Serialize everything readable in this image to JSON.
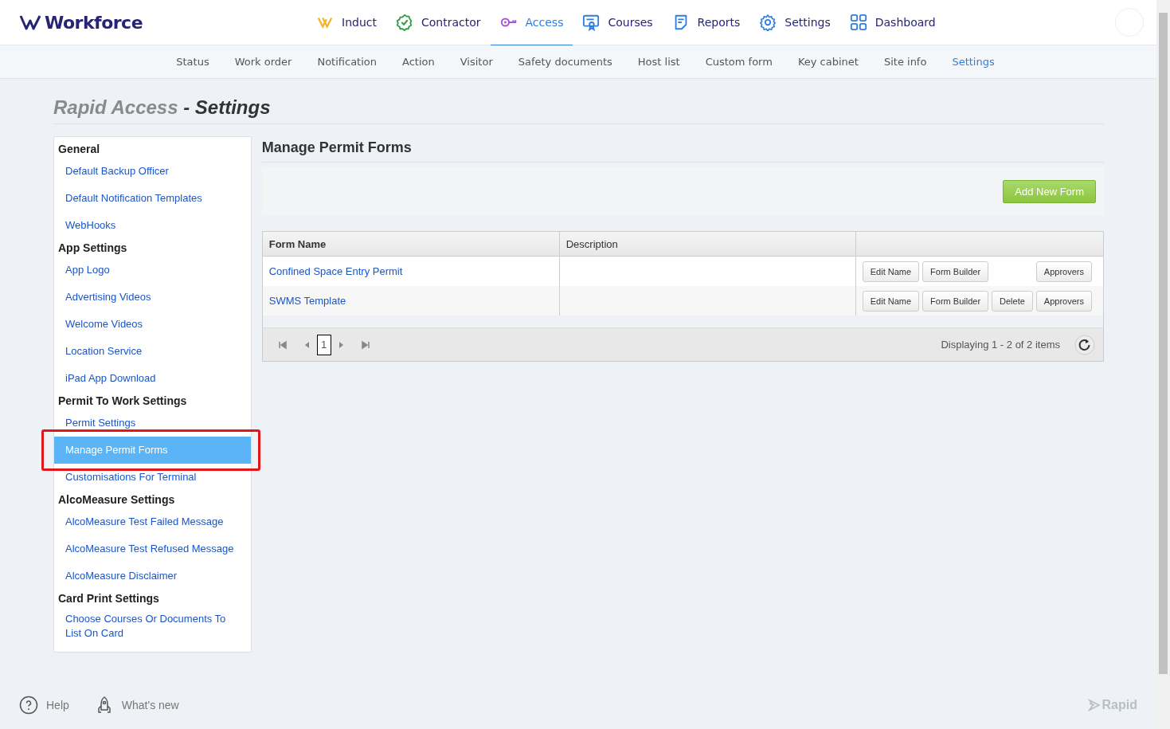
{
  "header": {
    "logo": "Workforce",
    "nav": [
      {
        "label": "Induct",
        "selected": false
      },
      {
        "label": "Contractor",
        "selected": false
      },
      {
        "label": "Access",
        "selected": true
      },
      {
        "label": "Courses",
        "selected": false
      },
      {
        "label": "Reports",
        "selected": false
      },
      {
        "label": "Settings",
        "selected": false
      },
      {
        "label": "Dashboard",
        "selected": false
      }
    ]
  },
  "subnav": [
    {
      "label": "Status",
      "selected": false
    },
    {
      "label": "Work order",
      "selected": false
    },
    {
      "label": "Notification",
      "selected": false
    },
    {
      "label": "Action",
      "selected": false
    },
    {
      "label": "Visitor",
      "selected": false
    },
    {
      "label": "Safety documents",
      "selected": false
    },
    {
      "label": "Host list",
      "selected": false
    },
    {
      "label": "Custom form",
      "selected": false
    },
    {
      "label": "Key cabinet",
      "selected": false
    },
    {
      "label": "Site info",
      "selected": false
    },
    {
      "label": "Settings",
      "selected": true
    }
  ],
  "page": {
    "title_prefix": "Rapid Access",
    "title": " - Settings"
  },
  "sidebar": {
    "groups": [
      {
        "heading": "General",
        "items": [
          {
            "label": "Default Backup Officer",
            "selected": false
          },
          {
            "label": "Default Notification Templates",
            "selected": false
          },
          {
            "label": "WebHooks",
            "selected": false
          }
        ]
      },
      {
        "heading": "App Settings",
        "items": [
          {
            "label": "App Logo",
            "selected": false
          },
          {
            "label": "Advertising Videos",
            "selected": false
          },
          {
            "label": "Welcome Videos",
            "selected": false
          },
          {
            "label": "Location Service",
            "selected": false
          },
          {
            "label": "iPad App Download",
            "selected": false
          }
        ]
      },
      {
        "heading": "Permit To Work Settings",
        "items": [
          {
            "label": "Permit Settings",
            "selected": false
          },
          {
            "label": "Manage Permit Forms",
            "selected": true
          },
          {
            "label": "Customisations For Terminal",
            "selected": false
          }
        ]
      },
      {
        "heading": "AlcoMeasure Settings",
        "items": [
          {
            "label": "AlcoMeasure Test Failed Message",
            "selected": false
          },
          {
            "label": "AlcoMeasure Test Refused Message",
            "selected": false
          },
          {
            "label": "AlcoMeasure Disclaimer",
            "selected": false
          }
        ]
      },
      {
        "heading": "Card Print Settings",
        "items": [
          {
            "label": "Choose Courses Or Documents To List On Card",
            "selected": false
          }
        ]
      }
    ]
  },
  "main": {
    "heading": "Manage Permit Forms",
    "add_button": "Add New Form",
    "table": {
      "columns": [
        "Form Name",
        "Description"
      ],
      "rows": [
        {
          "name": "Confined Space Entry Permit",
          "actions": [
            {
              "label": "Edit Name",
              "kind": "edit"
            },
            {
              "label": "Form Builder",
              "kind": "builder"
            },
            {
              "label": "Approvers",
              "kind": "approvers"
            }
          ]
        },
        {
          "name": "SWMS Template",
          "actions": [
            {
              "label": "Edit Name",
              "kind": "edit"
            },
            {
              "label": "Form Builder",
              "kind": "builder"
            },
            {
              "label": "Delete",
              "kind": "delete"
            },
            {
              "label": "Approvers",
              "kind": "approvers"
            }
          ]
        }
      ],
      "pages": [
        {
          "label": "1",
          "selected": true
        }
      ],
      "summary": "Displaying 1 - 2 of 2 items"
    }
  },
  "footer": {
    "help": "Help",
    "whats_new": "What's new",
    "brand": "Rapid"
  }
}
